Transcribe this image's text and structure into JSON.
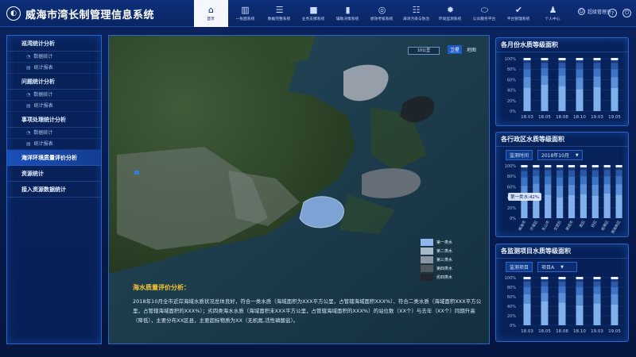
{
  "header": {
    "title": "威海市湾长制管理信息系统",
    "nav": [
      {
        "label": "首页",
        "icon": "home-icon",
        "glyph": "⌂",
        "active": true
      },
      {
        "label": "一张图系统",
        "icon": "map-icon",
        "glyph": "▥"
      },
      {
        "label": "数据完整系统",
        "icon": "database-icon",
        "glyph": "☰"
      },
      {
        "label": "业务支撑系统",
        "icon": "square-icon",
        "glyph": "■"
      },
      {
        "label": "辅助决策系统",
        "icon": "bar-chart-icon",
        "glyph": "▮"
      },
      {
        "label": "绩效考核系统",
        "icon": "medal-icon",
        "glyph": "◎"
      },
      {
        "label": "海湾污染与防治",
        "icon": "list-icon",
        "glyph": "☷"
      },
      {
        "label": "环境监测系统",
        "icon": "gear-icon",
        "glyph": "✹"
      },
      {
        "label": "公众服务平台",
        "icon": "car-icon",
        "glyph": "⬭"
      },
      {
        "label": "平台管理系统",
        "icon": "check-icon",
        "glyph": "✔"
      },
      {
        "label": "个人中心",
        "icon": "person-icon",
        "glyph": "♟"
      }
    ],
    "user": "超级管理员"
  },
  "sidebar": {
    "groups": [
      {
        "label": "巡湾统计分析",
        "items": [
          "数据统计",
          "统计报表"
        ]
      },
      {
        "label": "问题统计分析",
        "items": [
          "数据统计",
          "统计报表"
        ]
      },
      {
        "label": "事项处理统计分析",
        "items": [
          "数据统计",
          "统计报表"
        ]
      },
      {
        "label": "海洋环境质量评价分析",
        "items": [],
        "active": true
      },
      {
        "label": "资源统计",
        "items": []
      },
      {
        "label": "接入资源数据统计",
        "items": []
      }
    ]
  },
  "map": {
    "scale": "10公里",
    "toggle": [
      "卫星",
      "地图"
    ],
    "legend": [
      {
        "label": "第一类水",
        "color": "#8fb6ee"
      },
      {
        "label": "第二类水",
        "color": "#a9b9cc"
      },
      {
        "label": "第三类水",
        "color": "#8a96a4"
      },
      {
        "label": "第四类水",
        "color": "#50575f"
      },
      {
        "label": "劣四类水",
        "color": "#22272c"
      }
    ],
    "analysis_title": "海水质量评价分析：",
    "analysis_text": "2018年10月全市近岸海域水质状况总体良好，符合一类水质（海域面积为XXX平方公里，占管辖海域面积XXX%）、符合二类水质（海域面积XXX平方公里，占管辖海域面积的XXX%）；劣四类海水水质（海域面积未XXX平方公里，占管辖海域面积的XXX%）的站位数（XX个）与去年（XX个）同期升高（降低），主要分布XX区县，主要超标物质为XX（无机氮,活性磷酸盐）。"
  },
  "panels": {
    "monthly": {
      "title": "各月份水质等级面积"
    },
    "district": {
      "title": "各行政区水质等级面积",
      "filter_label": "监测时间",
      "filter_value": "2018年10月",
      "tooltip": "第一类水:42%"
    },
    "project": {
      "title": "各监测项目水质等级面积",
      "filter_label": "监测项目",
      "filter_value": "项目A"
    }
  },
  "chart_data": [
    {
      "type": "bar",
      "stacked": true,
      "title": "各月份水质等级面积",
      "categories": [
        "18.03",
        "18.05",
        "18.08",
        "18.10",
        "19.03",
        "19.05"
      ],
      "yticks": [
        "100%",
        "80%",
        "60%",
        "40%",
        "20%",
        "0%"
      ],
      "ylim": [
        0,
        100
      ],
      "series": [
        {
          "values": [
            45,
            50,
            48,
            42,
            46,
            44
          ]
        },
        {
          "values": [
            20,
            18,
            20,
            22,
            20,
            21
          ]
        },
        {
          "values": [
            15,
            14,
            14,
            16,
            15,
            15
          ]
        },
        {
          "values": [
            12,
            10,
            10,
            12,
            11,
            12
          ]
        },
        {
          "values": [
            8,
            8,
            8,
            8,
            8,
            8
          ]
        }
      ]
    },
    {
      "type": "bar",
      "stacked": true,
      "title": "各行政区水质等级面积",
      "categories": [
        "威海市",
        "环翠区",
        "乳山市",
        "文登区",
        "荣成市",
        "高区",
        "经区",
        "临港区",
        "南海新区"
      ],
      "yticks": [
        "100%",
        "80%",
        "60%",
        "40%",
        "20%",
        "0%"
      ],
      "ylim": [
        0,
        100
      ],
      "series": [
        {
          "values": [
            42,
            48,
            45,
            40,
            44,
            46,
            43,
            47,
            45
          ]
        },
        {
          "values": [
            20,
            18,
            20,
            22,
            20,
            19,
            21,
            18,
            20
          ]
        },
        {
          "values": [
            16,
            14,
            15,
            16,
            15,
            15,
            15,
            15,
            15
          ]
        },
        {
          "values": [
            12,
            12,
            12,
            13,
            12,
            12,
            12,
            12,
            12
          ]
        },
        {
          "values": [
            10,
            8,
            8,
            9,
            9,
            8,
            9,
            8,
            8
          ]
        }
      ]
    },
    {
      "type": "bar",
      "stacked": true,
      "title": "各监测项目水质等级面积",
      "categories": [
        "18.03",
        "18.05",
        "18.08",
        "18.10",
        "19.03",
        "19.05"
      ],
      "yticks": [
        "100%",
        "80%",
        "60%",
        "40%",
        "20%",
        "0%"
      ],
      "ylim": [
        0,
        100
      ],
      "series": [
        {
          "values": [
            45,
            50,
            48,
            42,
            46,
            44
          ]
        },
        {
          "values": [
            20,
            18,
            20,
            22,
            20,
            21
          ]
        },
        {
          "values": [
            15,
            14,
            14,
            16,
            15,
            15
          ]
        },
        {
          "values": [
            12,
            10,
            10,
            12,
            11,
            12
          ]
        },
        {
          "values": [
            8,
            8,
            8,
            8,
            8,
            8
          ]
        }
      ]
    }
  ],
  "colors": {
    "series": [
      "#7fb0ec",
      "#5b8fd8",
      "#3d73c4",
      "#2a57a6",
      "#1a3b80"
    ]
  }
}
